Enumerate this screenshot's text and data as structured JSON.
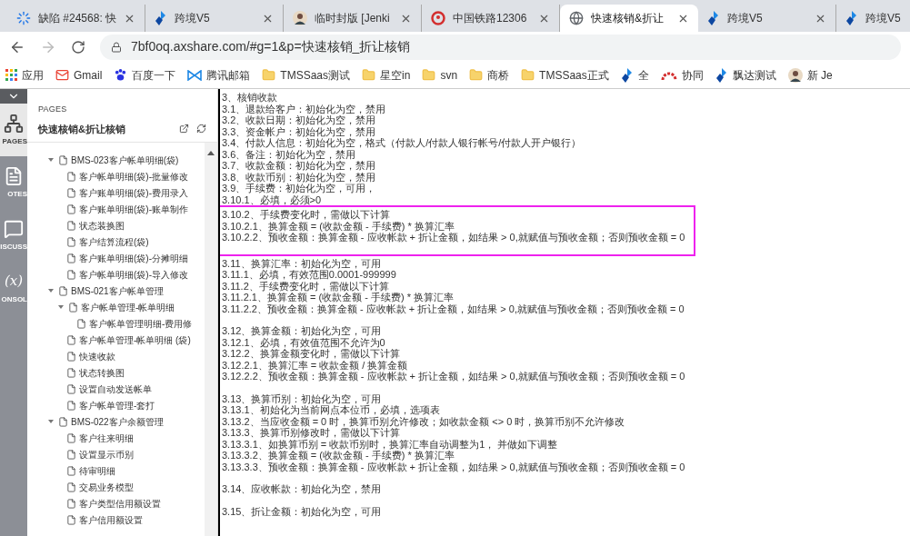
{
  "tabs": [
    {
      "title": "缺陷 #24568: 快",
      "selected": false
    },
    {
      "title": "跨境V5",
      "selected": false
    },
    {
      "title": "临时封版 [Jenki",
      "selected": false
    },
    {
      "title": "中国铁路12306",
      "selected": false
    },
    {
      "title": "快速核销&折让",
      "selected": true
    },
    {
      "title": "跨境V5",
      "selected": false
    },
    {
      "title": "跨境V5",
      "selected": false
    }
  ],
  "address": {
    "url": "7bf0oq.axshare.com/#g=1&p=快速核销_折让核销"
  },
  "bookmarks": [
    {
      "label": "应用"
    },
    {
      "label": "Gmail"
    },
    {
      "label": "百度一下"
    },
    {
      "label": "腾讯邮箱"
    },
    {
      "label": "TMSSaas测试"
    },
    {
      "label": "星空in"
    },
    {
      "label": "svn"
    },
    {
      "label": "商桥"
    },
    {
      "label": "TMSSaas正式"
    },
    {
      "label": "全"
    },
    {
      "label": "协同"
    },
    {
      "label": "飘达测试"
    },
    {
      "label": "新 Je"
    }
  ],
  "rail": [
    {
      "label": "PAGES",
      "selected": true
    },
    {
      "label": "OTES",
      "selected": false
    },
    {
      "label": "ISCUSS",
      "selected": false
    },
    {
      "label": "ONSOL",
      "glyph": "(x)",
      "selected": false
    }
  ],
  "pages_panel": {
    "heading": "PAGES",
    "title": "快速核销&折让核销",
    "tree": [
      {
        "label": "BMS-023客户帐单明细(袋)",
        "expanded": true,
        "children": [
          {
            "label": "客户帐单明细(袋)-批量修改"
          },
          {
            "label": "客户账单明细(袋)-费用录入"
          },
          {
            "label": "客户账单明细(袋)-账单制作"
          },
          {
            "label": "状态装换图"
          },
          {
            "label": "客户结算流程(袋)"
          },
          {
            "label": "客户账单明细(袋)-分摊明细"
          },
          {
            "label": "客户帐单明细(袋)-导入修改"
          }
        ]
      },
      {
        "label": "BMS-021客户帐单管理",
        "expanded": true,
        "children": [
          {
            "label": "客户帐单管理-帐单明细",
            "expanded": true,
            "children": [
              {
                "label": "客户帐单管理明细-费用修"
              }
            ]
          },
          {
            "label": "客户帐单管理-帐单明细 (袋)"
          },
          {
            "label": "快速收款"
          },
          {
            "label": "状态转换图"
          },
          {
            "label": "设置自动发送帐单"
          },
          {
            "label": "客户帐单管理-套打"
          }
        ]
      },
      {
        "label": "BMS-022客户余额管理",
        "expanded": true,
        "children": [
          {
            "label": "客户往来明细"
          },
          {
            "label": "设置显示币别"
          },
          {
            "label": "待审明细"
          },
          {
            "label": "交易业务模型"
          },
          {
            "label": "客户类型信用额设置"
          },
          {
            "label": "客户信用额设置"
          }
        ]
      }
    ]
  },
  "document": {
    "blocks": [
      {
        "kind": "plain",
        "lines": [
          "3、核销收款",
          "3.1、退款给客户：初始化为空，禁用",
          "3.2、收款日期：初始化为空，禁用",
          "3.3、资金帐户：初始化为空，禁用",
          "3.4、付款人信息：初始化为空，格式（付款人/付款人银行帐号/付款人开户银行）",
          "3.6、备注：初始化为空，禁用",
          "3.7、收款金额：初始化为空，禁用",
          "3.8、收款币别：初始化为空，禁用",
          "3.9、手续费：初始化为空，可用，",
          "3.10.1、必填，必须>0"
        ]
      },
      {
        "kind": "boxed",
        "lines": [
          "3.10.2、手续费变化时，需做以下计算",
          "3.10.2.1、换算金额 = (收款金额 - 手续费) * 换算汇率",
          "3.10.2.2、预收金额：换算金额 - 应收帐款 + 折让金额，如结果 > 0,就赋值与预收金额；否则预收金额 = 0"
        ]
      },
      {
        "kind": "plain",
        "lines": [
          "3.11、换算汇率：初始化为空，可用",
          "3.11.1、必填，有效范围0.0001-999999",
          "3.11.2、手续费变化时，需做以下计算",
          "3.11.2.1、换算金额 = (收款金额 - 手续费) * 换算汇率",
          "3.11.2.2、预收金额：换算金额 - 应收帐款 + 折让金额，如结果 > 0,就赋值与预收金额；否则预收金额 = 0"
        ]
      },
      {
        "kind": "plain",
        "lines": [
          "3.12、换算金额：初始化为空，可用",
          "3.12.1、必填，有效值范围不允许为0",
          "3.12.2、换算金额变化时，需做以下计算",
          "3.12.2.1、换算汇率 = 收款金额 / 换算金额",
          "3.12.2.2、预收金额：换算金额 - 应收帐款 + 折让金额，如结果 > 0,就赋值与预收金额；否则预收金额 = 0"
        ]
      },
      {
        "kind": "plain",
        "lines": [
          "3.13、换算币别：初始化为空，可用",
          "3.13.1、初始化为当前网点本位币，必填，选项表",
          "3.13.2、当应收金额 = 0 时，换算币别允许修改；如收款金额 <> 0 时，换算币别不允许修改",
          "3.13.3、换算币别修改时，需做以下计算",
          "3.13.3.1、如换算币别 = 收款币别时，换算汇率自动调整为1， 并做如下调整",
          "3.13.3.2、换算金额 = (收款金额 - 手续费) * 换算汇率",
          "3.13.3.3、预收金额：换算金额 - 应收帐款 + 折让金额，如结果 > 0,就赋值与预收金额；否则预收金额 = 0"
        ]
      },
      {
        "kind": "plain",
        "lines": [
          "3.14、应收帐款：初始化为空，禁用"
        ]
      },
      {
        "kind": "plain",
        "lines": [
          "3.15、折让金额：初始化为空，可用"
        ]
      }
    ]
  }
}
